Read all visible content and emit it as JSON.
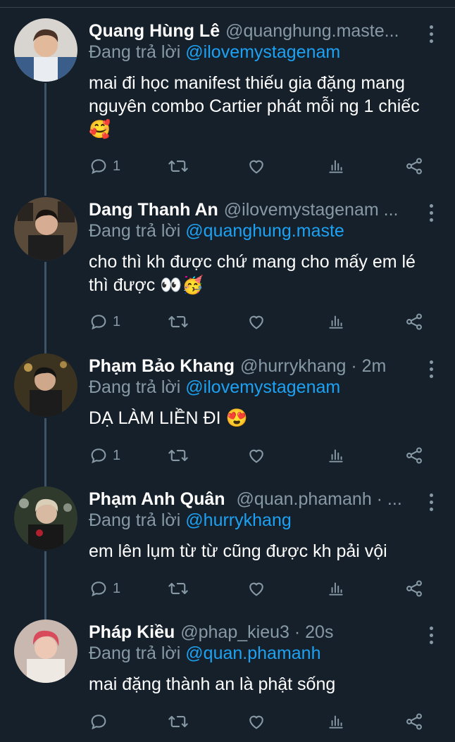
{
  "reply_prefix": "Đang trả lời",
  "tweets": [
    {
      "name": "Quang Hùng Lê",
      "handle": "@quanghung.maste...",
      "reply_to": "@ilovemystagenam",
      "text": "mai đi học manifest thiếu gia đặng mang nguyên combo Cartier phát mỗi ng 1 chiếc 🥰",
      "reply_count": "1",
      "avatar_icon": "profile-photo",
      "avatar_color": "#3a5d8a"
    },
    {
      "name": "Dang Thanh An",
      "handle": "@ilovemystagenam ...",
      "reply_to": "@quanghung.maste",
      "text": "cho thì kh được chứ mang cho mấy em lé thì được 👀🥳",
      "reply_count": "1",
      "avatar_icon": "profile-photo",
      "avatar_color": "#5a4a3a"
    },
    {
      "name": "Phạm Bảo Khang",
      "handle": "@hurrykhang · 2m",
      "reply_to": "@ilovemystagenam",
      "text": "DẠ LÀM LIỀN ĐI 😍",
      "reply_count": "1",
      "avatar_icon": "profile-photo",
      "avatar_color": "#3b3320"
    },
    {
      "name": "Phạm Anh Quân",
      "handle": "@quan.phamanh · ...",
      "reply_to": "@hurrykhang",
      "text": "em lên lụm từ từ cũng được kh pải vội",
      "reply_count": "1",
      "avatar_icon": "profile-photo",
      "avatar_color": "#2f3a2c"
    },
    {
      "name": "Pháp Kiều",
      "handle": "@phap_kieu3 · 20s",
      "reply_to": "@quan.phamanh",
      "text": "mai đặng thành an là phật sống",
      "reply_count": "",
      "avatar_icon": "profile-photo",
      "avatar_color": "#c9b8b0"
    }
  ],
  "colors": {
    "background": "#15202b",
    "secondary_text": "#8899a6",
    "mention": "#1da1f2",
    "divider": "#38444d",
    "thread_line": "#3d5466"
  }
}
